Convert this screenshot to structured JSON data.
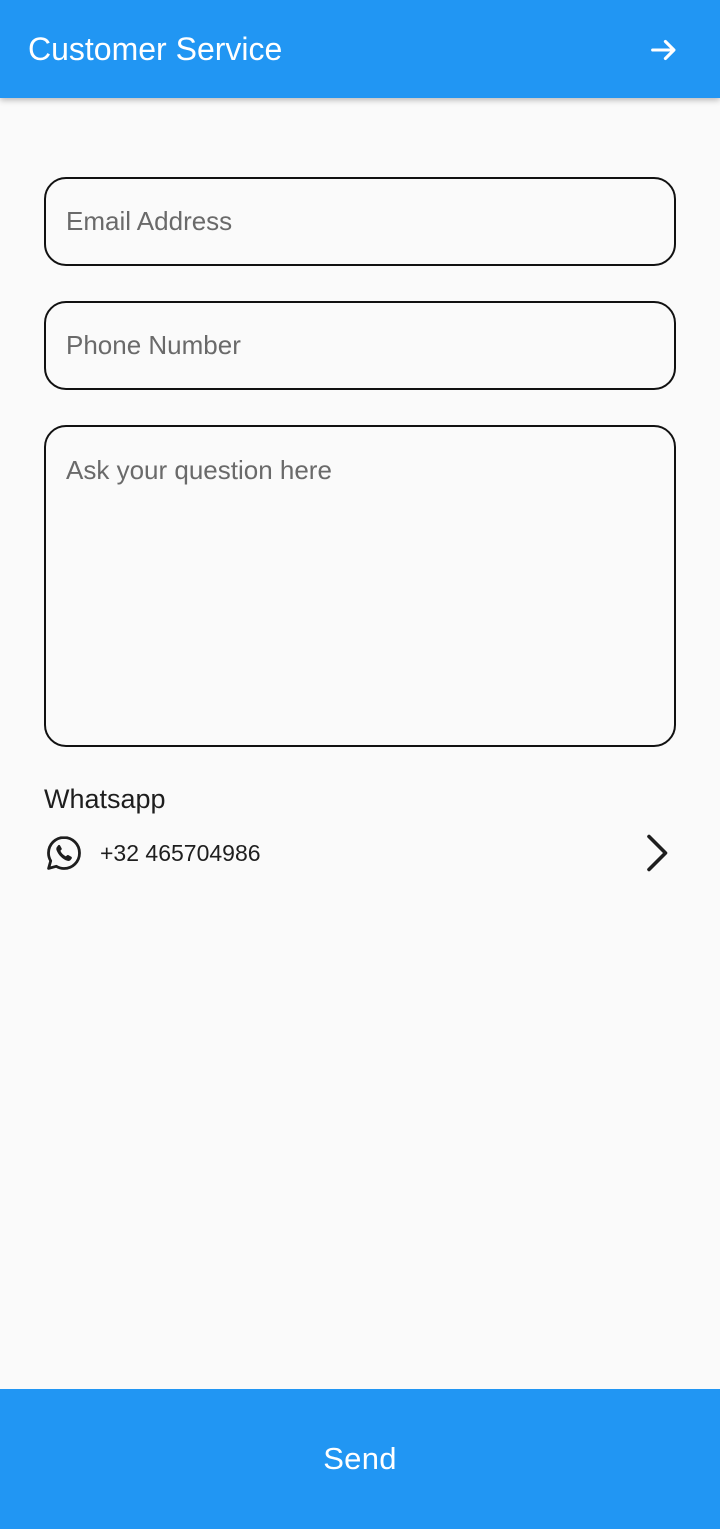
{
  "colors": {
    "primary": "#2196F3",
    "background": "#FAFAFA",
    "text": "#1E1E1E",
    "placeholder": "#6A6A6A",
    "border": "#111111"
  },
  "app_bar": {
    "title": "Customer Service",
    "action_icon": "arrow-right-icon"
  },
  "form": {
    "email": {
      "value": "",
      "placeholder": "Email Address"
    },
    "phone": {
      "value": "",
      "placeholder": "Phone Number"
    },
    "question": {
      "value": "",
      "placeholder": "Ask your question here"
    }
  },
  "whatsapp": {
    "title": "Whatsapp",
    "icon": "whatsapp-icon",
    "number": "+32 465704986",
    "chevron_icon": "chevron-right-icon"
  },
  "footer": {
    "send_label": "Send"
  }
}
